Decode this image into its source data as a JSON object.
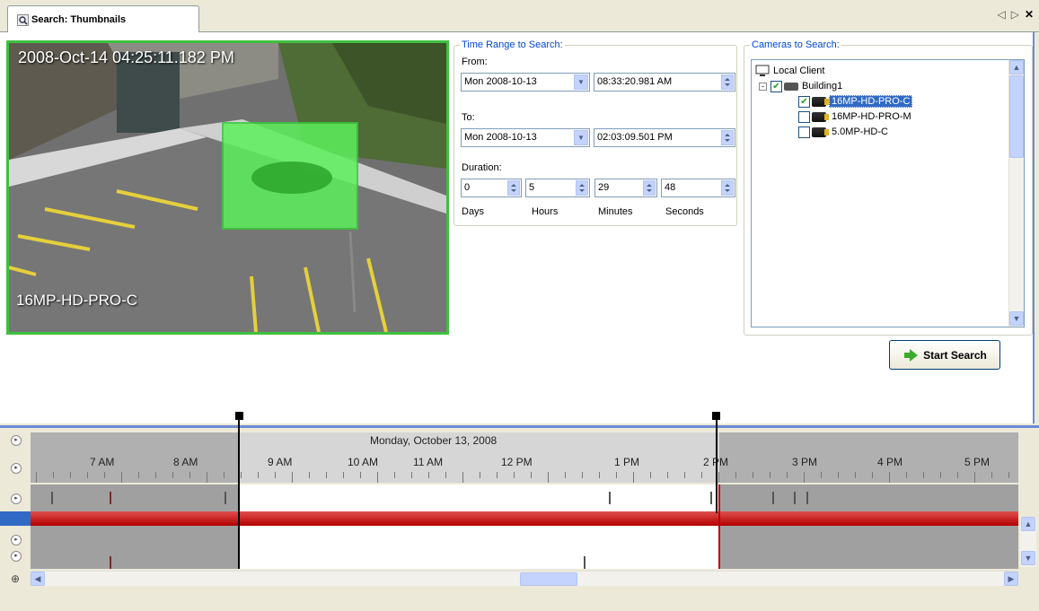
{
  "tab": {
    "label": "Search: Thumbnails"
  },
  "window_controls": {
    "prev": "◁",
    "next": "▷",
    "close": "✕"
  },
  "video": {
    "timestamp": "2008-Oct-14 04:25:11.182 PM",
    "camera_name": "16MP-HD-PRO-C",
    "border_color": "#3fbf3f"
  },
  "time_range": {
    "legend": "Time Range to Search:",
    "from_label": "From:",
    "from_date": "Mon 2008-10-13",
    "from_time": "08:33:20.981  AM",
    "to_label": "To:",
    "to_date": "Mon 2008-10-13",
    "to_time": "02:03:09.501  PM",
    "duration_label": "Duration:",
    "days": "0",
    "hours": "5",
    "minutes": "29",
    "seconds": "48",
    "days_label": "Days",
    "hours_label": "Hours",
    "minutes_label": "Minutes",
    "seconds_label": "Seconds"
  },
  "cameras": {
    "legend": "Cameras to Search:",
    "root": "Local Client",
    "site": "Building1",
    "items": [
      {
        "name": "16MP-HD-PRO-C",
        "checked": true,
        "selected": true
      },
      {
        "name": "16MP-HD-PRO-M",
        "checked": false,
        "selected": false
      },
      {
        "name": "5.0MP-HD-C",
        "checked": false,
        "selected": false
      }
    ]
  },
  "start_search": {
    "label": "Start Search"
  },
  "timeline": {
    "date": "Monday, October 13, 2008",
    "hours": [
      "7 AM",
      "8 AM",
      "9 AM",
      "10 AM",
      "11 AM",
      "12 PM",
      "1 PM",
      "2 PM",
      "3 PM",
      "4 PM",
      "5 PM"
    ]
  }
}
